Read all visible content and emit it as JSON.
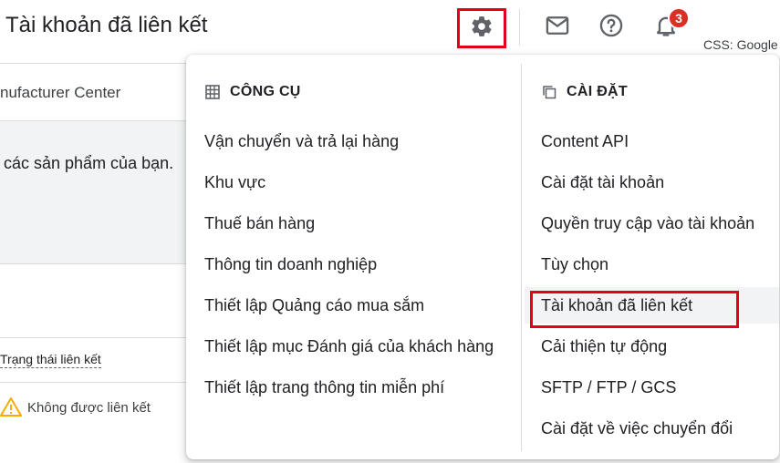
{
  "header": {
    "title": "Tài khoản đã liên kết",
    "notification_count": "3",
    "side_label": "CSS: Google"
  },
  "background": {
    "manufacturer_label": "nufacturer Center",
    "products_text": "các sản phẩm của bạn.",
    "status_column_header": "Trạng thái liên kết",
    "status_value": "Không được liên kết"
  },
  "tools": {
    "heading": "CÔNG CỤ",
    "items": [
      "Vận chuyển và trả lại hàng",
      "Khu vực",
      "Thuế bán hàng",
      "Thông tin doanh nghiệp",
      "Thiết lập Quảng cáo mua sắm",
      "Thiết lập mục Đánh giá của khách hàng",
      "Thiết lập trang thông tin miễn phí"
    ]
  },
  "settings": {
    "heading": "CÀI ĐẶT",
    "items": [
      "Content API",
      "Cài đặt tài khoản",
      "Quyền truy cập vào tài khoản",
      "Tùy chọn",
      "Tài khoản đã liên kết",
      "Cải thiện tự động",
      "SFTP / FTP / GCS",
      "Cài đặt về việc chuyển đổi"
    ],
    "active_item": "Tài khoản đã liên kết"
  },
  "colors": {
    "highlight_red": "#e3001b",
    "badge_red": "#d93025",
    "warning_yellow": "#f9ab00",
    "icon_grey": "#5f6368"
  }
}
